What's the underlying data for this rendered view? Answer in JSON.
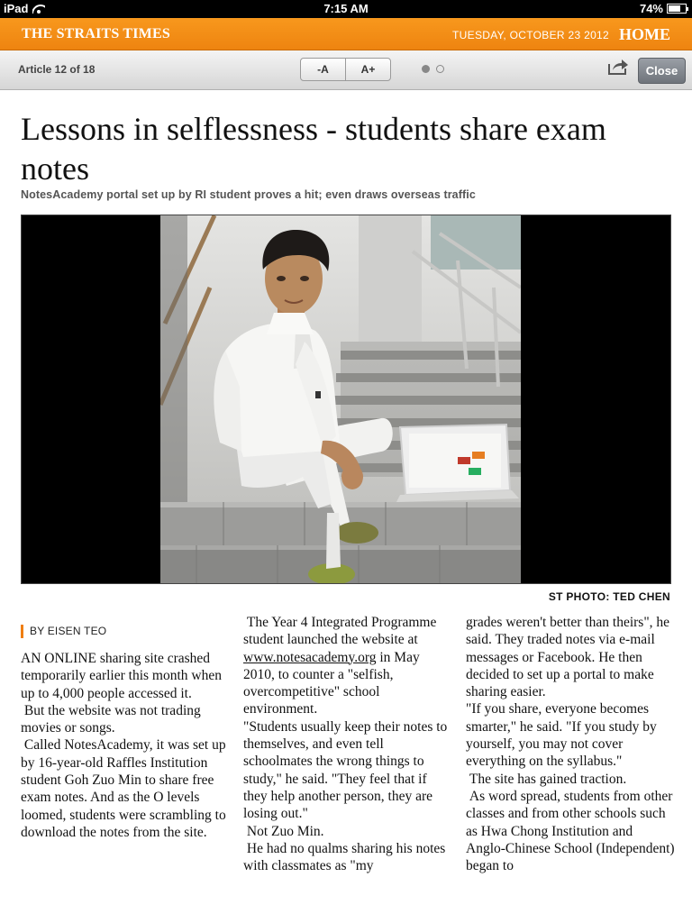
{
  "status_bar": {
    "device": "iPad",
    "time": "7:15 AM",
    "battery": "74%",
    "battery_level": 0.74
  },
  "masthead": {
    "logo": "THE STRAITS TIMES",
    "date": "TUESDAY, OCTOBER 23 2012",
    "home": "HOME"
  },
  "toolbar": {
    "article_count": "Article 12 of 18",
    "font_smaller": "-A",
    "font_larger": "A+",
    "close": "Close",
    "page_dots": 2,
    "active_dot": 0
  },
  "article": {
    "headline": "Lessons in selflessness - students share exam notes",
    "subhead": "NotesAcademy portal set up by RI student proves a hit; even draws overseas traffic",
    "photo_credit": "ST PHOTO: TED CHEN",
    "byline": "BY EISEN TEO",
    "col1": [
      "AN ONLINE sharing site crashed temporarily earlier this month when up to 4,000 people accessed it.",
      " But the website was not trading movies or songs.",
      " Called NotesAcademy, it was set up by 16-year-old Raffles Institution student Goh Zuo Min to share free exam notes. And as the O levels loomed, students were scrambling to download the notes from the site."
    ],
    "col2": {
      "p1_before": " The Year 4 Integrated Programme student launched the website at ",
      "p1_link": "www.notesacademy.org",
      "p1_after": " in May 2010, to counter a \"selfish, overcompetitive\" school environment.",
      "rest": [
        "\"Students usually keep their notes to themselves, and even tell schoolmates the wrong things to study,\" he said. \"They feel that if they help another person, they are losing out.\"",
        " Not Zuo Min.",
        " He had no qualms sharing his notes with classmates as \"my"
      ]
    },
    "col3": [
      "grades weren't better than theirs\", he said. They traded notes via e-mail messages or Facebook. He then decided to set up a portal to make sharing easier.",
      "\"If you share, everyone becomes smarter,\" he said. \"If you study by yourself, you may not cover everything on the syllabus.\"",
      " The site has gained traction.",
      " As word spread, students from other classes and from other schools such as Hwa Chong Institution and Anglo-Chinese School (Independent) began to"
    ]
  },
  "colors": {
    "masthead_orange": "#f28c14",
    "byline_accent": "#ef7e12",
    "close_button": "#7e838a"
  },
  "icons": [
    "wifi-icon",
    "battery-icon",
    "share-icon"
  ]
}
